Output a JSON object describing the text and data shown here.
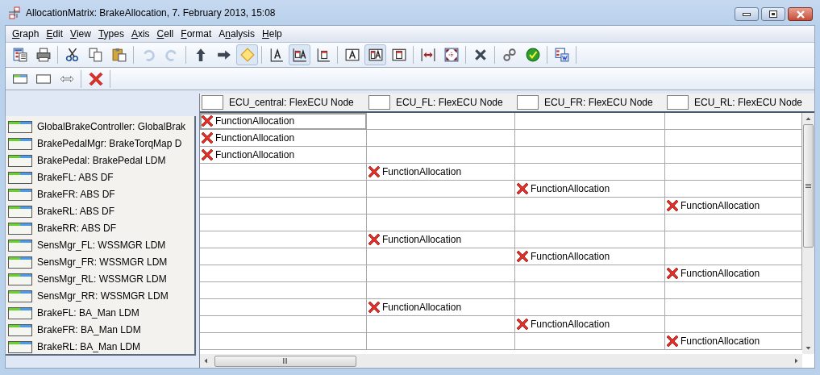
{
  "window": {
    "title": "AllocationMatrix: BrakeAllocation, 7. February 2013, 15:08"
  },
  "menu": [
    {
      "mnemonic": "G",
      "after": "raph"
    },
    {
      "mnemonic": "E",
      "after": "dit"
    },
    {
      "mnemonic": "V",
      "after": "iew"
    },
    {
      "mnemonic": "T",
      "after": "ypes"
    },
    {
      "mnemonic": "A",
      "after": "xis"
    },
    {
      "mnemonic": "C",
      "after": "ell"
    },
    {
      "mnemonic": "F",
      "after": "ormat"
    },
    {
      "before": "A",
      "mnemonic": "n",
      "after": "alysis"
    },
    {
      "mnemonic": "H",
      "after": "elp"
    }
  ],
  "toolbars": [
    {
      "groups": [
        [
          {
            "kind": "report",
            "pressed": false,
            "disabled": false
          },
          {
            "kind": "print",
            "pressed": false,
            "disabled": false
          }
        ],
        [
          {
            "kind": "cut",
            "pressed": false,
            "disabled": false
          },
          {
            "kind": "copy",
            "pressed": false,
            "disabled": false
          },
          {
            "kind": "paste",
            "pressed": false,
            "disabled": false
          }
        ],
        [
          {
            "kind": "undo",
            "pressed": false,
            "disabled": true
          },
          {
            "kind": "redo",
            "pressed": false,
            "disabled": true
          }
        ],
        [
          {
            "kind": "arrow-up",
            "pressed": false,
            "disabled": false
          },
          {
            "kind": "arrow-right",
            "pressed": false,
            "disabled": false
          },
          {
            "kind": "diamond",
            "pressed": true,
            "disabled": false
          }
        ],
        [
          {
            "kind": "axis-text",
            "pressed": false,
            "disabled": false
          },
          {
            "kind": "axis-text-box",
            "pressed": true,
            "disabled": false
          },
          {
            "kind": "axis-box",
            "pressed": false,
            "disabled": false
          }
        ],
        [
          {
            "kind": "text",
            "pressed": false,
            "disabled": false
          },
          {
            "kind": "text-box",
            "pressed": true,
            "disabled": false
          },
          {
            "kind": "box",
            "pressed": false,
            "disabled": false
          }
        ],
        [
          {
            "kind": "expand",
            "pressed": false,
            "disabled": false
          },
          {
            "kind": "fit",
            "pressed": false,
            "disabled": false
          }
        ],
        [
          {
            "kind": "delete",
            "pressed": false,
            "disabled": false
          }
        ],
        [
          {
            "kind": "link",
            "pressed": false,
            "disabled": false
          },
          {
            "kind": "validate",
            "pressed": false,
            "disabled": false
          }
        ],
        [
          {
            "kind": "export",
            "pressed": false,
            "disabled": false
          }
        ]
      ]
    },
    {
      "groups": [
        [
          {
            "kind": "row-style",
            "pressed": false,
            "disabled": false
          },
          {
            "kind": "blank",
            "pressed": false,
            "disabled": false
          },
          {
            "kind": "double-arrow",
            "pressed": false,
            "disabled": false
          }
        ],
        [
          {
            "kind": "remove",
            "pressed": false,
            "disabled": false
          }
        ]
      ]
    }
  ],
  "columns": [
    {
      "label": "ECU_central: FlexECU Node"
    },
    {
      "label": "ECU_FL: FlexECU Node"
    },
    {
      "label": "ECU_FR: FlexECU Node"
    },
    {
      "label": "ECU_RL: FlexECU Node"
    }
  ],
  "rows": [
    {
      "label": "GlobalBrakeController: GlobalBrak",
      "cells": [
        {
          "kind": "allocation",
          "text": "FunctionAllocation",
          "selected": true
        },
        {
          "kind": "empty",
          "selected": false
        },
        {
          "kind": "empty",
          "selected": false
        },
        {
          "kind": "empty",
          "selected": false
        }
      ]
    },
    {
      "label": "BrakePedalMgr: BrakeTorqMap D",
      "cells": [
        {
          "kind": "allocation",
          "text": "FunctionAllocation",
          "selected": false
        },
        {
          "kind": "empty",
          "selected": false
        },
        {
          "kind": "empty",
          "selected": false
        },
        {
          "kind": "empty",
          "selected": false
        }
      ]
    },
    {
      "label": "BrakePedal: BrakePedal LDM",
      "cells": [
        {
          "kind": "allocation",
          "text": "FunctionAllocation",
          "selected": false
        },
        {
          "kind": "empty",
          "selected": false
        },
        {
          "kind": "empty",
          "selected": false
        },
        {
          "kind": "empty",
          "selected": false
        }
      ]
    },
    {
      "label": "BrakeFL: ABS DF",
      "cells": [
        {
          "kind": "empty",
          "selected": false
        },
        {
          "kind": "allocation",
          "text": "FunctionAllocation",
          "selected": false
        },
        {
          "kind": "empty",
          "selected": false
        },
        {
          "kind": "empty",
          "selected": false
        }
      ]
    },
    {
      "label": "BrakeFR: ABS DF",
      "cells": [
        {
          "kind": "empty",
          "selected": false
        },
        {
          "kind": "empty",
          "selected": false
        },
        {
          "kind": "allocation",
          "text": "FunctionAllocation",
          "selected": false
        },
        {
          "kind": "empty",
          "selected": false
        }
      ]
    },
    {
      "label": "BrakeRL: ABS DF",
      "cells": [
        {
          "kind": "empty",
          "selected": false
        },
        {
          "kind": "empty",
          "selected": false
        },
        {
          "kind": "empty",
          "selected": false
        },
        {
          "kind": "allocation",
          "text": "FunctionAllocation",
          "selected": false
        }
      ]
    },
    {
      "label": "BrakeRR: ABS DF",
      "cells": [
        {
          "kind": "empty",
          "selected": false
        },
        {
          "kind": "empty",
          "selected": false
        },
        {
          "kind": "empty",
          "selected": false
        },
        {
          "kind": "empty",
          "selected": false
        }
      ]
    },
    {
      "label": "SensMgr_FL: WSSMGR LDM",
      "cells": [
        {
          "kind": "empty",
          "selected": false
        },
        {
          "kind": "allocation",
          "text": "FunctionAllocation",
          "selected": false
        },
        {
          "kind": "empty",
          "selected": false
        },
        {
          "kind": "empty",
          "selected": false
        }
      ]
    },
    {
      "label": "SensMgr_FR: WSSMGR LDM",
      "cells": [
        {
          "kind": "empty",
          "selected": false
        },
        {
          "kind": "empty",
          "selected": false
        },
        {
          "kind": "allocation",
          "text": "FunctionAllocation",
          "selected": false
        },
        {
          "kind": "empty",
          "selected": false
        }
      ]
    },
    {
      "label": "SensMgr_RL: WSSMGR LDM",
      "cells": [
        {
          "kind": "empty",
          "selected": false
        },
        {
          "kind": "empty",
          "selected": false
        },
        {
          "kind": "empty",
          "selected": false
        },
        {
          "kind": "allocation",
          "text": "FunctionAllocation",
          "selected": false
        }
      ]
    },
    {
      "label": "SensMgr_RR: WSSMGR LDM",
      "cells": [
        {
          "kind": "empty",
          "selected": false
        },
        {
          "kind": "empty",
          "selected": false
        },
        {
          "kind": "empty",
          "selected": false
        },
        {
          "kind": "empty",
          "selected": false
        }
      ]
    },
    {
      "label": "BrakeFL: BA_Man LDM",
      "cells": [
        {
          "kind": "empty",
          "selected": false
        },
        {
          "kind": "allocation",
          "text": "FunctionAllocation",
          "selected": false
        },
        {
          "kind": "empty",
          "selected": false
        },
        {
          "kind": "empty",
          "selected": false
        }
      ]
    },
    {
      "label": "BrakeFR: BA_Man LDM",
      "cells": [
        {
          "kind": "empty",
          "selected": false
        },
        {
          "kind": "empty",
          "selected": false
        },
        {
          "kind": "allocation",
          "text": "FunctionAllocation",
          "selected": false
        },
        {
          "kind": "empty",
          "selected": false
        }
      ]
    },
    {
      "label": "BrakeRL: BA_Man LDM",
      "cells": [
        {
          "kind": "empty",
          "selected": false
        },
        {
          "kind": "empty",
          "selected": false
        },
        {
          "kind": "empty",
          "selected": false
        },
        {
          "kind": "allocation",
          "text": "FunctionAllocation",
          "selected": false
        }
      ]
    }
  ]
}
